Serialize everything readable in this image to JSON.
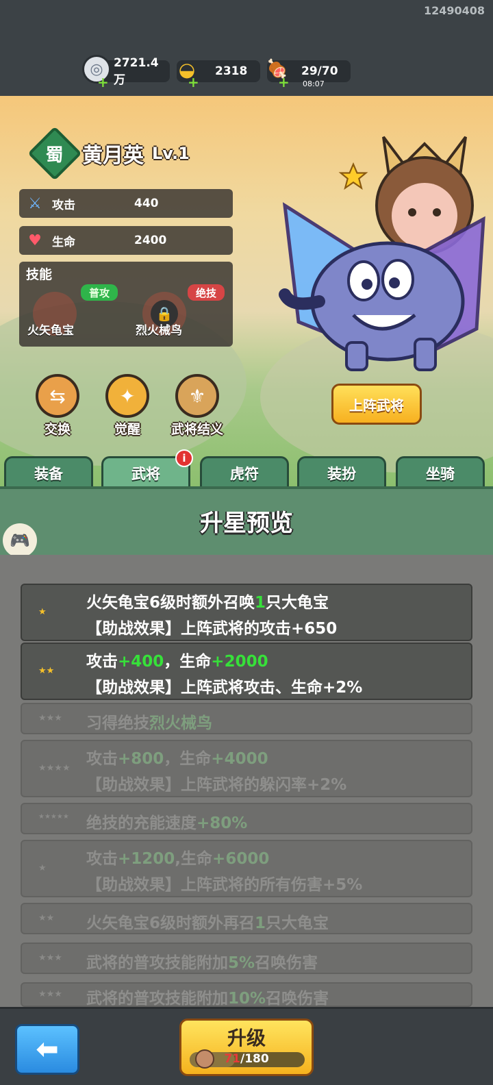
{
  "uid": "12490408",
  "resources": {
    "silver": "2721.4万",
    "gold": "2318",
    "stamina": "29/70",
    "stamina_timer": "08:07"
  },
  "hero": {
    "faction": "蜀",
    "name": "黄月英",
    "level": "Lv.1"
  },
  "stats": {
    "attack_label": "攻击",
    "attack_value": "440",
    "hp_label": "生命",
    "hp_value": "2400"
  },
  "skills": {
    "title": "技能",
    "normal_tag": "普攻",
    "normal_name": "火矢龟宝",
    "ultimate_tag": "绝技",
    "ultimate_name": "烈火械鸟"
  },
  "actions": {
    "swap": "交换",
    "awaken": "觉醒",
    "bond": "武将结义"
  },
  "deploy_button": "上阵武将",
  "tabs": [
    "装备",
    "武将",
    "虎符",
    "装扮",
    "坐骑"
  ],
  "tab_badge": "i",
  "panel_title": "升星预览",
  "star_rows": [
    {
      "stars": "★",
      "l1_a": "火矢龟宝6级时额外召唤",
      "l1_g": "1",
      "l1_b": "只大龟宝",
      "l2": "【助战效果】上阵武将的攻击+650",
      "locked": false
    },
    {
      "stars": "★★",
      "l1_a": "攻击",
      "l1_g": "+400",
      "l1_b": "，生命",
      "l1_g2": "+2000",
      "l2": "【助战效果】上阵武将攻击、生命+2%",
      "locked": false
    },
    {
      "stars": "★★★",
      "l1_a": "习得绝技",
      "l1_g": "烈火械鸟",
      "locked": true
    },
    {
      "stars": "★★★★",
      "l1_a": "攻击",
      "l1_g": "+800",
      "l1_b": "，生命",
      "l1_g2": "+4000",
      "l2": "【助战效果】上阵武将的躲闪率+2%",
      "locked": true
    },
    {
      "stars": "★★★★★",
      "l1_a": "绝技的充能速度",
      "l1_g": "+80%",
      "locked": true
    },
    {
      "stars": "★",
      "l1_a": "攻击",
      "l1_g": "+1200",
      "l1_b": ",生命",
      "l1_g2": "+6000",
      "l2": "【助战效果】上阵武将的所有伤害+5%",
      "locked": true
    },
    {
      "stars": "★★",
      "l1_a": "火矢龟宝6级时额外再召",
      "l1_g": "1",
      "l1_b": "只大龟宝",
      "locked": true
    },
    {
      "stars": "★★★",
      "l1_a": "武将的普攻技能附加",
      "l1_g": "5%",
      "l1_b": "召唤伤害",
      "locked": true
    },
    {
      "stars": "★★★",
      "l1_a": "武将的普攻技能附加",
      "l1_g": "10%",
      "l1_b": "召唤伤害",
      "locked": true
    }
  ],
  "upgrade": {
    "label": "升级",
    "current": "71",
    "total": "/180",
    "progress": 0.39
  }
}
